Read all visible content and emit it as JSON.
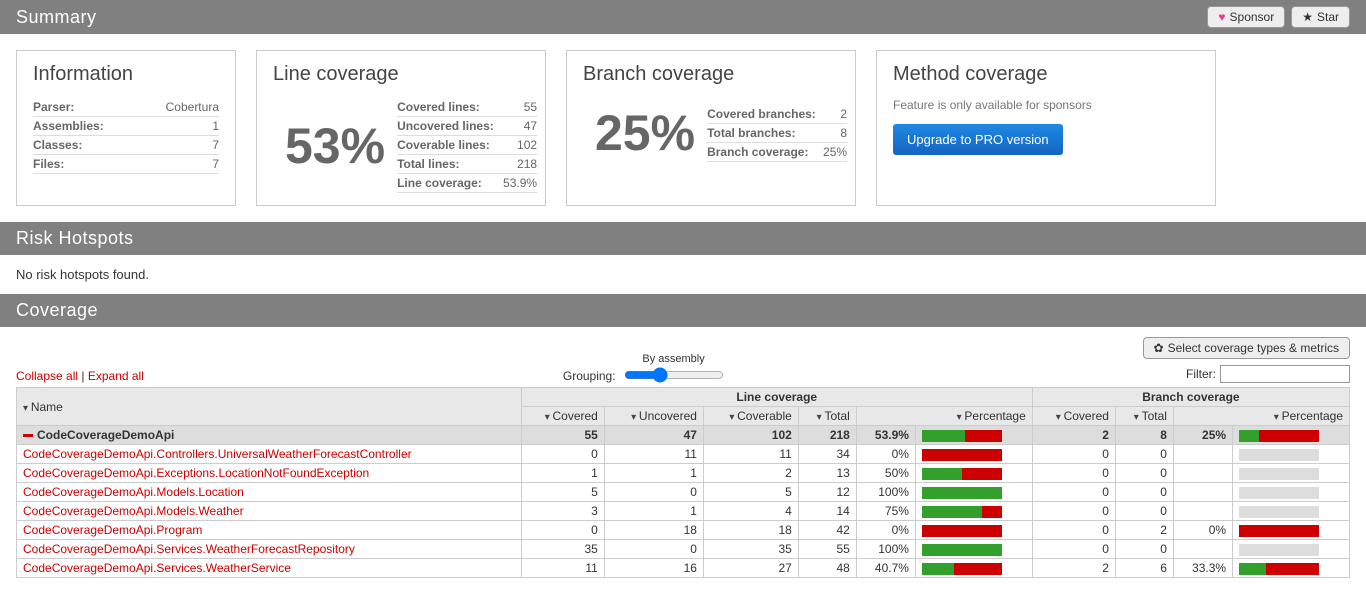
{
  "header": {
    "summary": "Summary",
    "sponsor": "Sponsor",
    "star": "Star",
    "risk_hotspots": "Risk Hotspots",
    "coverage": "Coverage"
  },
  "info_card": {
    "title": "Information",
    "rows": [
      {
        "k": "Parser:",
        "v": "Cobertura"
      },
      {
        "k": "Assemblies:",
        "v": "1"
      },
      {
        "k": "Classes:",
        "v": "7"
      },
      {
        "k": "Files:",
        "v": "7"
      }
    ]
  },
  "line_card": {
    "title": "Line coverage",
    "big": "53%",
    "rows": [
      {
        "k": "Covered lines:",
        "v": "55"
      },
      {
        "k": "Uncovered lines:",
        "v": "47"
      },
      {
        "k": "Coverable lines:",
        "v": "102"
      },
      {
        "k": "Total lines:",
        "v": "218"
      },
      {
        "k": "Line coverage:",
        "v": "53.9%"
      }
    ]
  },
  "branch_card": {
    "title": "Branch coverage",
    "big": "25%",
    "rows": [
      {
        "k": "Covered branches:",
        "v": "2"
      },
      {
        "k": "Total branches:",
        "v": "8"
      },
      {
        "k": "Branch coverage:",
        "v": "25%"
      }
    ]
  },
  "method_card": {
    "title": "Method coverage",
    "note": "Feature is only available for sponsors",
    "button": "Upgrade to PRO version"
  },
  "risk": {
    "none": "No risk hotspots found."
  },
  "controls": {
    "collapse": "Collapse all",
    "expand": "Expand all",
    "sep": " | ",
    "grouping": "Grouping:",
    "slider_label": "By assembly",
    "select_metrics": "Select coverage types & metrics",
    "filter": "Filter:"
  },
  "table": {
    "group_line": "Line coverage",
    "group_branch": "Branch coverage",
    "cols": {
      "name": "Name",
      "covered": "Covered",
      "uncovered": "Uncovered",
      "coverable": "Coverable",
      "total": "Total",
      "percentage": "Percentage"
    },
    "total": {
      "name": "CodeCoverageDemoApi",
      "covered": "55",
      "uncovered": "47",
      "coverable": "102",
      "total": "218",
      "pct": "53.9%",
      "pct_n": 53.9,
      "b_covered": "2",
      "b_total": "8",
      "b_pct": "25%",
      "b_pct_n": 25
    },
    "rows": [
      {
        "name": "CodeCoverageDemoApi.Controllers.UniversalWeatherForecastController",
        "covered": "0",
        "uncovered": "11",
        "coverable": "11",
        "total": "34",
        "pct": "0%",
        "pct_n": 0,
        "b_covered": "0",
        "b_total": "0",
        "b_pct": "",
        "b_pct_n": null
      },
      {
        "name": "CodeCoverageDemoApi.Exceptions.LocationNotFoundException",
        "covered": "1",
        "uncovered": "1",
        "coverable": "2",
        "total": "13",
        "pct": "50%",
        "pct_n": 50,
        "b_covered": "0",
        "b_total": "0",
        "b_pct": "",
        "b_pct_n": null
      },
      {
        "name": "CodeCoverageDemoApi.Models.Location",
        "covered": "5",
        "uncovered": "0",
        "coverable": "5",
        "total": "12",
        "pct": "100%",
        "pct_n": 100,
        "b_covered": "0",
        "b_total": "0",
        "b_pct": "",
        "b_pct_n": null
      },
      {
        "name": "CodeCoverageDemoApi.Models.Weather",
        "covered": "3",
        "uncovered": "1",
        "coverable": "4",
        "total": "14",
        "pct": "75%",
        "pct_n": 75,
        "b_covered": "0",
        "b_total": "0",
        "b_pct": "",
        "b_pct_n": null
      },
      {
        "name": "CodeCoverageDemoApi.Program",
        "covered": "0",
        "uncovered": "18",
        "coverable": "18",
        "total": "42",
        "pct": "0%",
        "pct_n": 0,
        "b_covered": "0",
        "b_total": "2",
        "b_pct": "0%",
        "b_pct_n": 0
      },
      {
        "name": "CodeCoverageDemoApi.Services.WeatherForecastRepository",
        "covered": "35",
        "uncovered": "0",
        "coverable": "35",
        "total": "55",
        "pct": "100%",
        "pct_n": 100,
        "b_covered": "0",
        "b_total": "0",
        "b_pct": "",
        "b_pct_n": null
      },
      {
        "name": "CodeCoverageDemoApi.Services.WeatherService",
        "covered": "11",
        "uncovered": "16",
        "coverable": "27",
        "total": "48",
        "pct": "40.7%",
        "pct_n": 40.7,
        "b_covered": "2",
        "b_total": "6",
        "b_pct": "33.3%",
        "b_pct_n": 33.3
      }
    ]
  }
}
